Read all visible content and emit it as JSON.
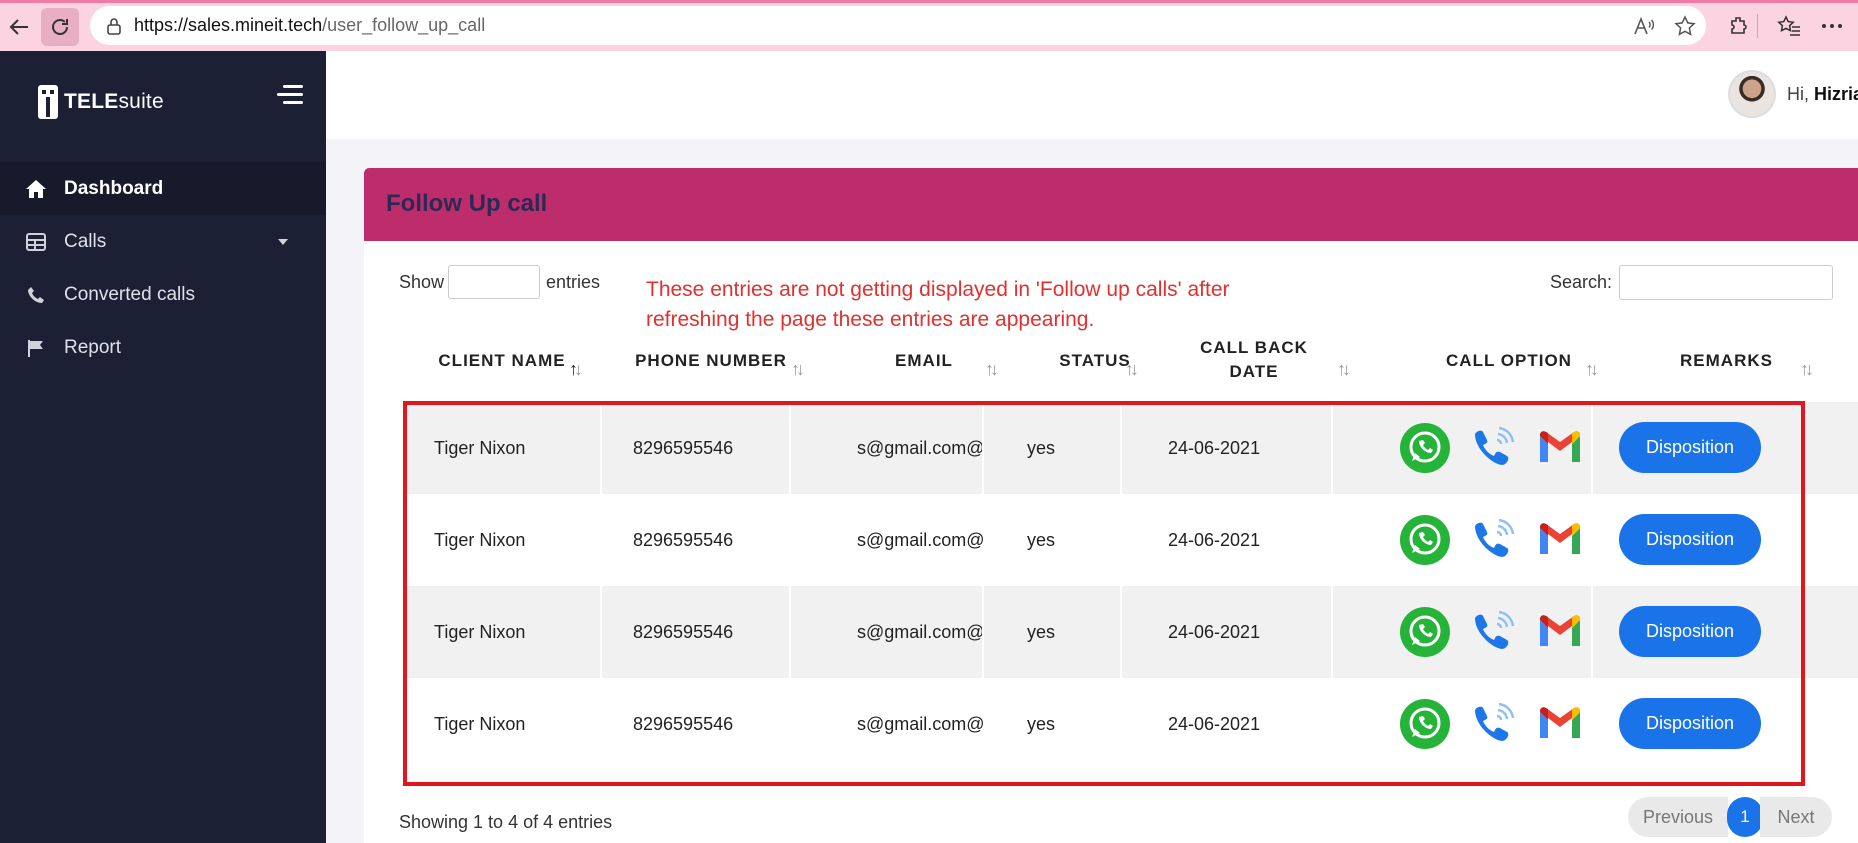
{
  "browser": {
    "url_host": "https://sales.mineit.tech",
    "url_path": "/user_follow_up_call"
  },
  "sidebar": {
    "logo": {
      "bold": "TELE",
      "light": "suite"
    },
    "items": [
      {
        "label": "Dashboard",
        "icon": "home-icon"
      },
      {
        "label": "Calls",
        "icon": "table-icon"
      },
      {
        "label": "Converted calls",
        "icon": "phone-icon"
      },
      {
        "label": "Report",
        "icon": "flag-icon"
      }
    ]
  },
  "header": {
    "greeting": "Hi,",
    "user_name": "Hizria"
  },
  "card": {
    "title": "Follow Up call",
    "show_label": "Show",
    "entries_label": "entries",
    "search_label": "Search:",
    "annotation": "These entries are not getting displayed in 'Follow up calls' after refreshing the page these entries are appearing."
  },
  "table": {
    "columns": [
      "CLIENT NAME",
      "PHONE NUMBER",
      "EMAIL",
      "STATUS",
      "CALL BACK DATE",
      "CALL OPTION",
      "REMARKS"
    ],
    "rows": [
      {
        "client_name": "Tiger Nixon",
        "phone": "8296595546",
        "email": "s@gmail.com@",
        "status": "yes",
        "date": "24-06-2021",
        "remarks_button": "Disposition"
      },
      {
        "client_name": "Tiger Nixon",
        "phone": "8296595546",
        "email": "s@gmail.com@",
        "status": "yes",
        "date": "24-06-2021",
        "remarks_button": "Disposition"
      },
      {
        "client_name": "Tiger Nixon",
        "phone": "8296595546",
        "email": "s@gmail.com@",
        "status": "yes",
        "date": "24-06-2021",
        "remarks_button": "Disposition"
      },
      {
        "client_name": "Tiger Nixon",
        "phone": "8296595546",
        "email": "s@gmail.com@",
        "status": "yes",
        "date": "24-06-2021",
        "remarks_button": "Disposition"
      }
    ]
  },
  "footer": {
    "info": "Showing 1 to 4 of 4 entries",
    "previous": "Previous",
    "page": "1",
    "next": "Next"
  },
  "colors": {
    "sidebar_bg": "#1c2034",
    "card_header": "#bd2d6c",
    "title_text": "#2c2a55",
    "button_blue": "#1a73e8",
    "annotation_red": "#e0312f"
  }
}
